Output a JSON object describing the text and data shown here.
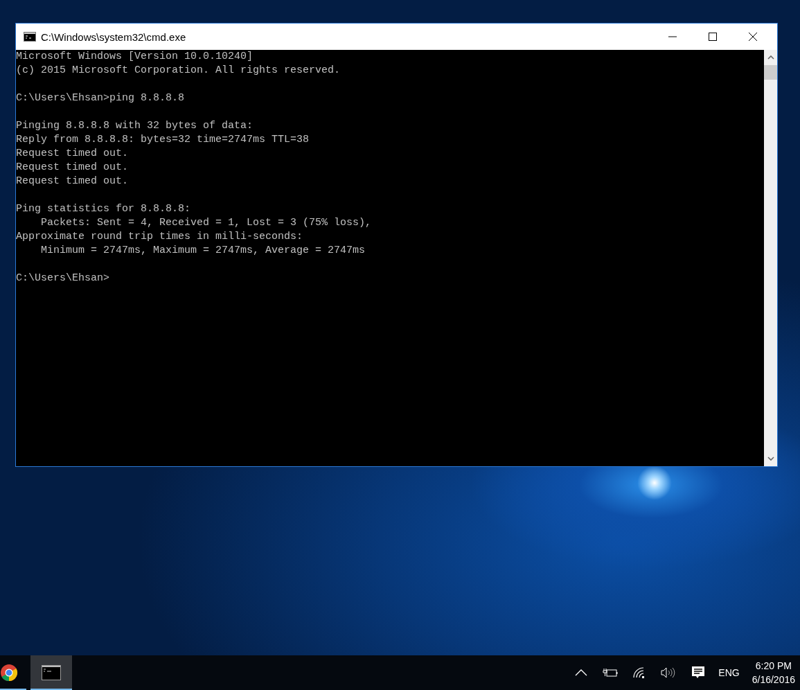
{
  "window": {
    "title": "C:\\Windows\\system32\\cmd.exe"
  },
  "console": {
    "blocks": [
      [
        "Microsoft Windows [Version 10.0.10240]",
        "(c) 2015 Microsoft Corporation. All rights reserved."
      ],
      [
        "C:\\Users\\Ehsan>ping 8.8.8.8"
      ],
      [
        "Pinging 8.8.8.8 with 32 bytes of data:",
        "Reply from 8.8.8.8: bytes=32 time=2747ms TTL=38",
        "Request timed out.",
        "Request timed out.",
        "Request timed out."
      ],
      [
        "Ping statistics for 8.8.8.8:",
        "    Packets: Sent = 4, Received = 1, Lost = 3 (75% loss),",
        "Approximate round trip times in milli-seconds:",
        "    Minimum = 2747ms, Maximum = 2747ms, Average = 2747ms"
      ],
      [
        "C:\\Users\\Ehsan>"
      ]
    ]
  },
  "taskbar": {
    "apps": [
      {
        "kind": "browser",
        "selected": false
      },
      {
        "kind": "console",
        "selected": true
      }
    ],
    "tray": {
      "language": "ENG",
      "time": "6:20 PM",
      "date": "6/16/2016"
    }
  }
}
